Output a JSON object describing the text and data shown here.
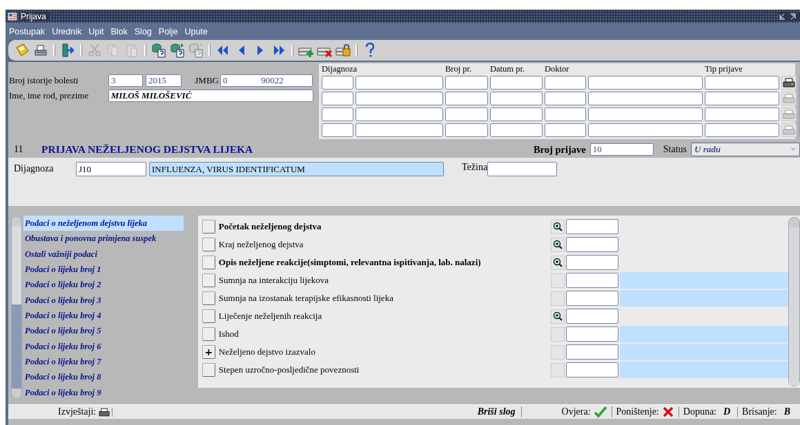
{
  "window": {
    "title": "Prijava"
  },
  "menu": [
    "Postupak",
    "Urednik",
    "Upit",
    "Blok",
    "Slog",
    "Polje",
    "Upute"
  ],
  "toolbar": [
    {
      "kind": "save",
      "disabled": false
    },
    {
      "kind": "print",
      "disabled": false
    },
    {
      "kind": "sep"
    },
    {
      "kind": "exit",
      "disabled": false
    },
    {
      "kind": "sep"
    },
    {
      "kind": "cut",
      "disabled": true
    },
    {
      "kind": "copy",
      "disabled": true
    },
    {
      "kind": "paste",
      "disabled": true
    },
    {
      "kind": "sep"
    },
    {
      "kind": "query",
      "disabled": false
    },
    {
      "kind": "query-run",
      "disabled": false
    },
    {
      "kind": "query-cancel",
      "disabled": true
    },
    {
      "kind": "sep"
    },
    {
      "kind": "first",
      "disabled": false
    },
    {
      "kind": "prev",
      "disabled": false
    },
    {
      "kind": "next",
      "disabled": false
    },
    {
      "kind": "last",
      "disabled": false
    },
    {
      "kind": "sep"
    },
    {
      "kind": "insert",
      "disabled": false
    },
    {
      "kind": "delete",
      "disabled": false
    },
    {
      "kind": "lock",
      "disabled": false
    },
    {
      "kind": "sep"
    },
    {
      "kind": "help",
      "disabled": false
    }
  ],
  "patient": {
    "history_label": "Broj istorije bolesti",
    "history_number": "3",
    "history_year": "2015",
    "jmbg_label": "JMBG",
    "jmbg_value": "0               90022",
    "name_label": "Ime, ime rod, prezime",
    "name_value": "MILOŠ MILOŠEVIĆ"
  },
  "table": {
    "columns": [
      {
        "header": "Dijagnoza"
      },
      {
        "header": "Broj pr."
      },
      {
        "header": "Datum pr."
      },
      {
        "header": "Doktor"
      },
      {
        "header": "Tip prijave"
      }
    ],
    "rows": [
      {
        "print_enabled": true
      },
      {
        "print_enabled": false
      },
      {
        "print_enabled": false
      },
      {
        "print_enabled": false
      }
    ]
  },
  "form": {
    "number": "11",
    "title": "PRIJAVA NEŽELJENOG DEJSTVA LIJEKA",
    "report_label": "Broj prijave",
    "report_value": "10",
    "status_label": "Status",
    "status_value": "U radu",
    "diagnosis_label": "Dijagnoza",
    "diagnosis_code": "J10",
    "diagnosis_name": "INFLUENZA, VIRUS IDENTIFICATUM",
    "severity_label": "Težina"
  },
  "sections": [
    {
      "label": "Podaci o neželjenom dejstvu lijeka",
      "selected": true
    },
    {
      "label": "Obustava i ponovna primjena suspek",
      "selected": false
    },
    {
      "label": "Ostali važniji podaci",
      "selected": false
    },
    {
      "label": "Podaci o lijeku broj 1",
      "selected": false
    },
    {
      "label": "Podaci o lijeku broj 2",
      "selected": false
    },
    {
      "label": "Podaci o lijeku broj 3",
      "selected": false
    },
    {
      "label": "Podaci o lijeku broj 4",
      "selected": false
    },
    {
      "label": "Podaci o lijeku broj 5",
      "selected": false
    },
    {
      "label": "Podaci o lijeku broj 6",
      "selected": false
    },
    {
      "label": "Podaci o lijeku broj 7",
      "selected": false
    },
    {
      "label": "Podaci o lijeku broj 8",
      "selected": false
    },
    {
      "label": "Podaci o lijeku broj 9",
      "selected": false
    }
  ],
  "fields": [
    {
      "label": "Početak neželjenog dejstva",
      "bold": true,
      "kind": "zoom",
      "highlighted": false
    },
    {
      "label": "Kraj neželjenog dejstva",
      "bold": false,
      "kind": "zoom",
      "highlighted": false
    },
    {
      "label": "Opis neželjene reakcije(simptomi, relevantna ispitivanja, lab. nalazi)",
      "bold": true,
      "kind": "zoom",
      "highlighted": false
    },
    {
      "label": "Sumnja na interakciju lijekova",
      "bold": false,
      "kind": "lov",
      "highlighted": true
    },
    {
      "label": "Sumnja na izostanak terapijske efikasnosti lijeka",
      "bold": false,
      "kind": "lov",
      "highlighted": true
    },
    {
      "label": "Liječenje neželjenih reakcija",
      "bold": false,
      "kind": "zoom",
      "highlighted": false
    },
    {
      "label": "Ishod",
      "bold": false,
      "kind": "lov",
      "highlighted": true
    },
    {
      "label": "Neželjeno dejstvo izazvalo",
      "bold": false,
      "kind": "lov",
      "highlighted": true,
      "expander": "+"
    },
    {
      "label": "Stepen uzročno-posljedične poveznosti",
      "bold": false,
      "kind": "lov",
      "highlighted": true
    }
  ],
  "status_bar": {
    "reports_label": "Izvještaji:",
    "delete_record": "Briši slog",
    "verify_label": "Ovjera:",
    "cancel_label": "Poništenje:",
    "append_label": "Dopuna:",
    "append_key": "D",
    "erase_label": "Brisanje:",
    "erase_key": "B"
  }
}
